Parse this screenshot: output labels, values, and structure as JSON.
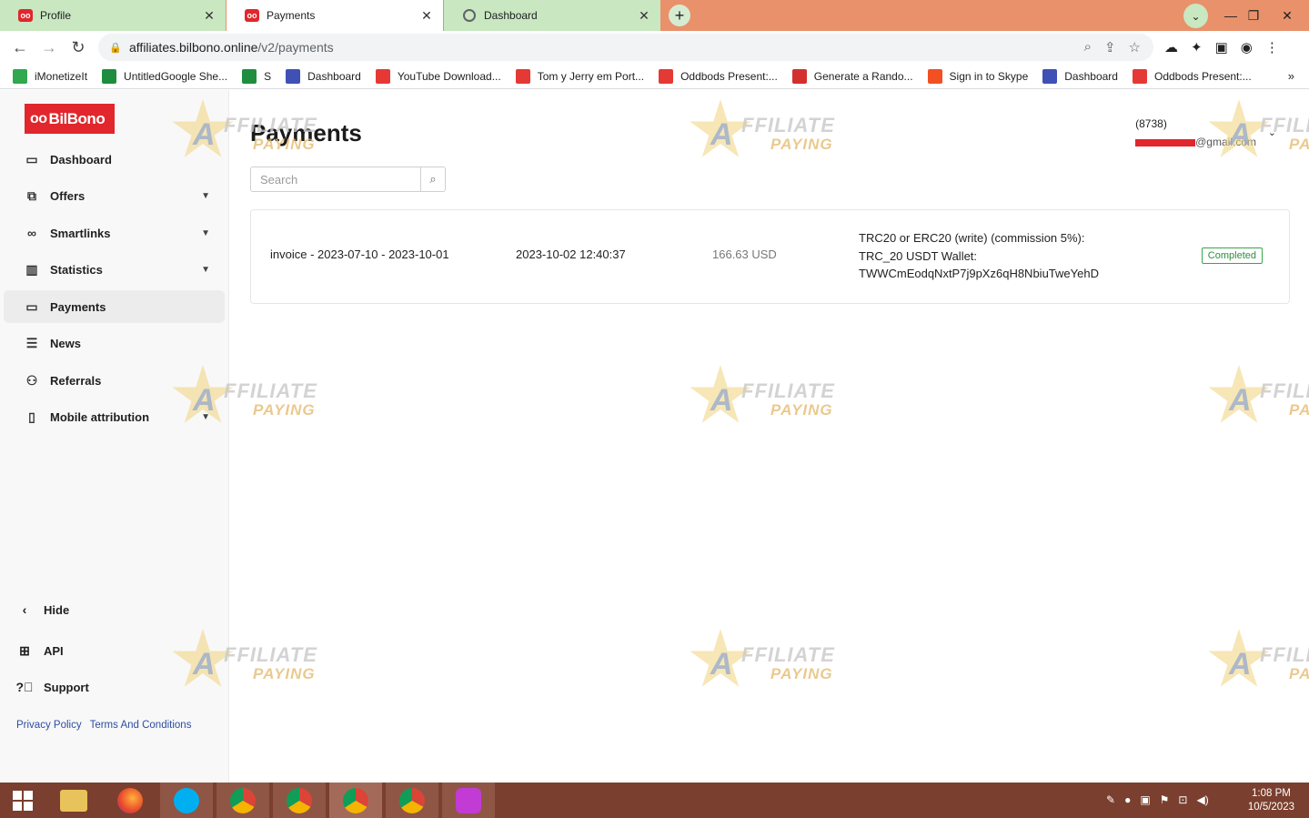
{
  "browser": {
    "tabs": [
      {
        "title": "Profile",
        "icon": "bilbono-logo-icon"
      },
      {
        "title": "Payments",
        "icon": "bilbono-logo-icon"
      },
      {
        "title": "Dashboard",
        "icon": "globe-icon"
      }
    ],
    "url_host": "affiliates.bilbono.online",
    "url_path": "/v2/payments",
    "bookmarks": [
      {
        "label": "iMonetizeIt",
        "color": "#2fa84f"
      },
      {
        "label": "UntitledGoogle She...",
        "color": "#1e8e3e"
      },
      {
        "label": "S",
        "color": "#1e8e3e"
      },
      {
        "label": "Dashboard",
        "color": "#3f51b5"
      },
      {
        "label": "YouTube Download...",
        "color": "#e53935"
      },
      {
        "label": "Tom y Jerry em Port...",
        "color": "#e53935"
      },
      {
        "label": "Oddbods Present:...",
        "color": "#e53935"
      },
      {
        "label": "Generate a Rando...",
        "color": "#d32f2f"
      },
      {
        "label": "Sign in to Skype",
        "color": "#f25022"
      },
      {
        "label": "Dashboard",
        "color": "#3f51b5"
      },
      {
        "label": "Oddbods Present:...",
        "color": "#e53935"
      }
    ]
  },
  "sidebar": {
    "brand": "BilBono",
    "items": [
      {
        "label": "Dashboard",
        "icon": "dashboard-icon",
        "expandable": false
      },
      {
        "label": "Offers",
        "icon": "offers-icon",
        "expandable": true
      },
      {
        "label": "Smartlinks",
        "icon": "link-icon",
        "expandable": true
      },
      {
        "label": "Statistics",
        "icon": "bar-chart-icon",
        "expandable": true
      },
      {
        "label": "Payments",
        "icon": "wallet-icon",
        "expandable": false
      },
      {
        "label": "News",
        "icon": "news-icon",
        "expandable": false
      },
      {
        "label": "Referrals",
        "icon": "referrals-icon",
        "expandable": false
      },
      {
        "label": "Mobile attribution",
        "icon": "mobile-icon",
        "expandable": true
      }
    ],
    "hide_label": "Hide",
    "api_label": "API",
    "support_label": "Support",
    "privacy_label": "Privacy Policy",
    "terms_label": "Terms And Conditions"
  },
  "main": {
    "title": "Payments",
    "search_placeholder": "Search",
    "user_id": "(8738)",
    "user_email_suffix": "@gmail.com",
    "payments": [
      {
        "invoice": "invoice - 2023-07-10 - 2023-10-01",
        "date": "2023-10-02 12:40:37",
        "amount": "166.63 USD",
        "method_line1": "TRC20 or ERC20 (write) (commission 5%):",
        "method_line2": "TRC_20 USDT Wallet:",
        "method_line3": "TWWCmEodqNxtP7j9pXz6qH8NbiuTweYehD",
        "status": "Completed"
      }
    ],
    "watermark_line1": "FFILIATE",
    "watermark_line2": "PAYING",
    "watermark_letter": "A"
  },
  "taskbar": {
    "time": "1:08 PM",
    "date": "10/5/2023"
  },
  "colors": {
    "brand_red": "#e1262d",
    "tab_strip": "#e8916a",
    "taskbar": "#7a3f2e",
    "status_green": "#2e8f3c"
  }
}
